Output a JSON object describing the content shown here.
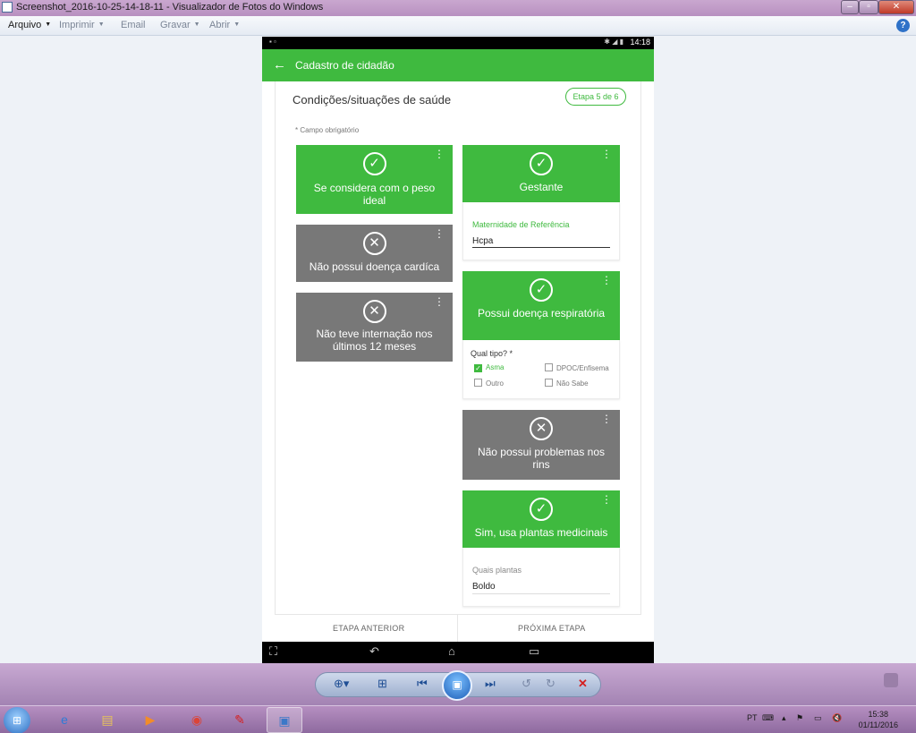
{
  "window": {
    "title": "Screenshot_2016-10-25-14-18-11 - Visualizador de Fotos do Windows",
    "minimize": "‒",
    "maximize": "▫",
    "close": "✕"
  },
  "menu": {
    "items": [
      {
        "label": "Arquivo",
        "has_caret": true
      },
      {
        "label": "Imprimir",
        "has_caret": true
      },
      {
        "label": "Email",
        "has_caret": false
      },
      {
        "label": "Gravar",
        "has_caret": true
      },
      {
        "label": "Abrir",
        "has_caret": true
      }
    ],
    "help": "?"
  },
  "phone": {
    "status_time": "14:18",
    "app_title": "Cadastro de cidadão",
    "back_icon": "arrow-left",
    "section_title": "Condições/situações de saúde",
    "stage_badge": "Etapa 5 de 6",
    "required_note": "* Campo obrigatório",
    "cards": {
      "peso": {
        "state": "yes",
        "icon": "check",
        "label_line1": "Se considera com o peso",
        "label_line2": "ideal"
      },
      "cardiaca": {
        "state": "no",
        "icon": "x",
        "label": "Não possui doença cardíca"
      },
      "internacao": {
        "state": "no",
        "icon": "x",
        "label_line1": "Não teve internação nos",
        "label_line2": "últimos 12 meses"
      },
      "gestante": {
        "state": "yes",
        "icon": "check",
        "label": "Gestante",
        "field_label": "Maternidade de Referência",
        "field_value": "Hcpa"
      },
      "respiratoria": {
        "state": "yes",
        "icon": "check",
        "label": "Possui doença respiratória",
        "question": "Qual tipo? *",
        "options": [
          {
            "label": "Asma",
            "checked": true
          },
          {
            "label": "DPOC/Enfisema",
            "checked": false
          },
          {
            "label": "Outro",
            "checked": false
          },
          {
            "label": "Não Sabe",
            "checked": false
          }
        ]
      },
      "rins": {
        "state": "no",
        "icon": "x",
        "label_line1": "Não possui problemas nos",
        "label_line2": "rins"
      },
      "plantas": {
        "state": "yes",
        "icon": "check",
        "label": "Sim, usa plantas medicinais",
        "field_label": "Quais plantas",
        "field_value": "Boldo"
      }
    },
    "nav": {
      "previous": "ETAPA ANTERIOR",
      "next": "PRÓXIMA ETAPA"
    }
  },
  "colors": {
    "accent": "#3fba3f",
    "inactive": "#787878"
  },
  "taskbar": {
    "apps": [
      "start",
      "internet-explorer",
      "file-explorer",
      "media-player",
      "chrome",
      "acrobat",
      "photo-viewer"
    ],
    "language": "PT",
    "time": "15:38",
    "date": "01/11/2016"
  }
}
